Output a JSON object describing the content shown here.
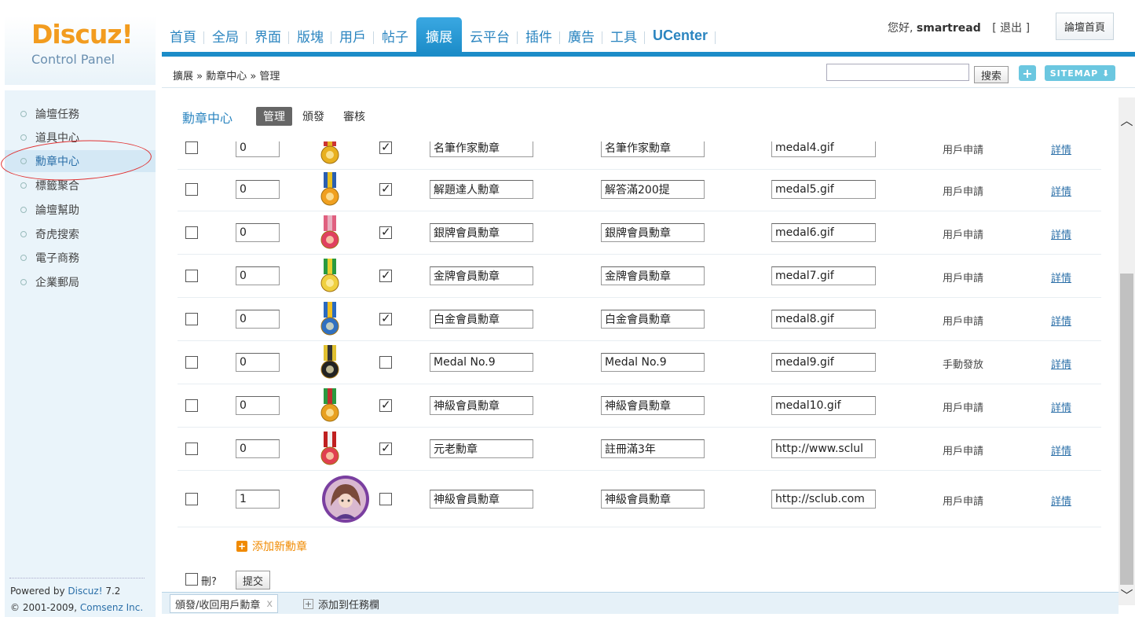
{
  "logo": {
    "main": "Discuz!",
    "sub": "Control Panel"
  },
  "nav": [
    {
      "label": "首頁"
    },
    {
      "label": "全局"
    },
    {
      "label": "界面"
    },
    {
      "label": "版塊"
    },
    {
      "label": "用戶"
    },
    {
      "label": "帖子"
    },
    {
      "label": "擴展",
      "active": true
    },
    {
      "label": "云平台"
    },
    {
      "label": "插件"
    },
    {
      "label": "廣告"
    },
    {
      "label": "工具"
    },
    {
      "label": "UCenter"
    }
  ],
  "user": {
    "greeting": "您好,",
    "name": "smartread",
    "logout": "[ 退出 ]",
    "home_button": "論壇首頁"
  },
  "breadcrumb": "擴展 » 勳章中心 » 管理",
  "search": {
    "value": "",
    "button": "搜索"
  },
  "toolbar": {
    "plus": "+",
    "sitemap": "SITEMAP"
  },
  "sidebar": {
    "items": [
      {
        "label": "論壇任務"
      },
      {
        "label": "道具中心"
      },
      {
        "label": "勳章中心",
        "active": true
      },
      {
        "label": "標籤聚合"
      },
      {
        "label": "論壇幫助"
      },
      {
        "label": "奇虎搜索"
      },
      {
        "label": "電子商務"
      },
      {
        "label": "企業郵局"
      }
    ],
    "powered_prefix": "Powered by ",
    "powered_name": "Discuz!",
    "powered_version": " 7.2",
    "copyright_prefix": "© 2001-2009, ",
    "copyright_name": "Comsenz Inc."
  },
  "main": {
    "title": "勳章中心",
    "tabs": [
      {
        "label": "管理",
        "active": true
      },
      {
        "label": "頒發"
      },
      {
        "label": "審核"
      }
    ],
    "rows": [
      {
        "order": "0",
        "available": true,
        "name": "名筆作家勳章",
        "desc": "名筆作家勳章",
        "image": "medal4.gif",
        "type": "用戶申請",
        "detail": "詳情",
        "medal": "star"
      },
      {
        "order": "0",
        "available": true,
        "name": "解題達人勳章",
        "desc": "解答滿200提",
        "image": "medal5.gif",
        "type": "用戶申請",
        "detail": "詳情",
        "medal": "sun"
      },
      {
        "order": "0",
        "available": true,
        "name": "銀牌會員勳章",
        "desc": "銀牌會員勳章",
        "image": "medal6.gif",
        "type": "用戶申請",
        "detail": "詳情",
        "medal": "flower"
      },
      {
        "order": "0",
        "available": true,
        "name": "金牌會員勳章",
        "desc": "金牌會員勳章",
        "image": "medal7.gif",
        "type": "用戶申請",
        "detail": "詳情",
        "medal": "hexstar"
      },
      {
        "order": "0",
        "available": true,
        "name": "白金會員勳章",
        "desc": "白金會員勳章",
        "image": "medal8.gif",
        "type": "用戶申請",
        "detail": "詳情",
        "medal": "blue"
      },
      {
        "order": "0",
        "available": false,
        "name": "Medal No.9",
        "desc": "Medal No.9",
        "image": "medal9.gif",
        "type": "手動發放",
        "detail": "詳情",
        "medal": "dark"
      },
      {
        "order": "0",
        "available": true,
        "name": "神級會員勳章",
        "desc": "神級會員勳章",
        "image": "medal10.gif",
        "type": "用戶申請",
        "detail": "詳情",
        "medal": "gold"
      },
      {
        "order": "0",
        "available": true,
        "name": "元老勳章",
        "desc": "註冊滿3年",
        "image": "http://www.sclul",
        "type": "用戶申請",
        "detail": "詳情",
        "medal": "heart"
      },
      {
        "order": "1",
        "available": false,
        "name": "神級會員勳章",
        "desc": "神級會員勳章",
        "image": "http://sclub.com",
        "type": "用戶申請",
        "detail": "詳情",
        "medal": "avatar"
      }
    ],
    "add_new": "添加新勳章",
    "delete_label": "刪?",
    "submit": "提交"
  },
  "taskbar": {
    "item": "頒發/收回用戶勳章",
    "close": "x",
    "add": "添加到任務欄",
    "add_icon": "+"
  },
  "colors": {
    "accent": "#1c8cc8",
    "logo": "#f29c1f",
    "link": "#2b6fa8",
    "add": "#f08a00"
  }
}
